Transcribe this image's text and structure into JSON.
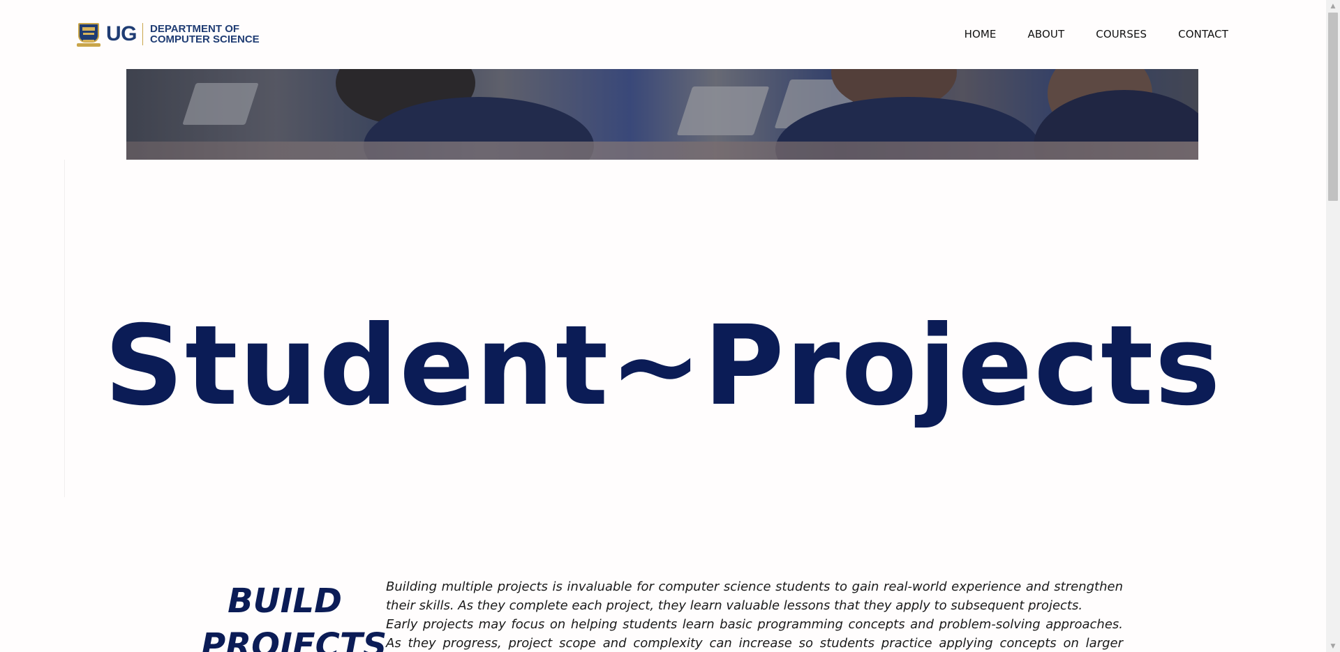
{
  "header": {
    "logo_text": "UG",
    "department_line1": "DEPARTMENT OF",
    "department_line2": "COMPUTER SCIENCE",
    "nav": [
      {
        "label": "HOME"
      },
      {
        "label": "ABOUT"
      },
      {
        "label": "COURSES"
      },
      {
        "label": "CONTACT"
      }
    ]
  },
  "hero": {
    "image": "students-with-laptops-photo"
  },
  "main": {
    "title": "Student~Projects",
    "build_heading": "BUILD PROJECTS",
    "build_paragraphs": [
      "Building multiple projects is invaluable for computer science students to gain real-world experience and strengthen their skills. As they complete each project, they learn valuable lessons that they apply to subsequent projects.",
      "Early projects may focus on helping students learn basic programming concepts and problem-solving approaches. As they progress, project scope and complexity can increase so students practice applying concepts on larger scales simulating"
    ]
  },
  "colors": {
    "brand_navy": "#0b1c56",
    "logo_blue": "#1f3c73",
    "logo_gold": "#c9a54a",
    "background": "#fffdfd"
  }
}
